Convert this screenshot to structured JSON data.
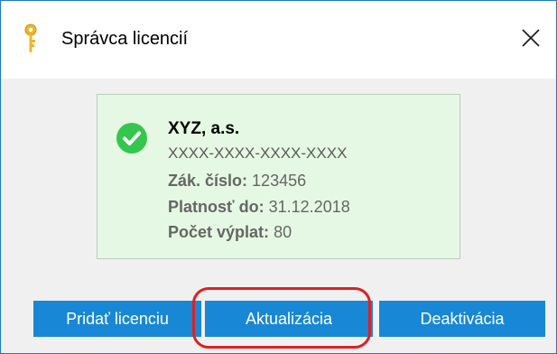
{
  "window": {
    "title": "Správca licencií"
  },
  "license": {
    "company": "XYZ, a.s.",
    "key": "XXXX-XXXX-XXXX-XXXX",
    "customer_number_label": "Zák. číslo:",
    "customer_number": "123456",
    "valid_until_label": "Platnosť do:",
    "valid_until": "31.12.2018",
    "payroll_count_label": "Počet výplat:",
    "payroll_count": "80"
  },
  "buttons": {
    "add_license": "Pridať licenciu",
    "update": "Aktualizácia",
    "deactivate": "Deaktivácia"
  },
  "icons": {
    "title": "key-icon",
    "close": "close-icon",
    "status": "check-circle-icon"
  },
  "colors": {
    "accent": "#1887d6",
    "success": "#35c64d",
    "card_background": "#e5f8e3",
    "highlight": "#dd2020"
  }
}
